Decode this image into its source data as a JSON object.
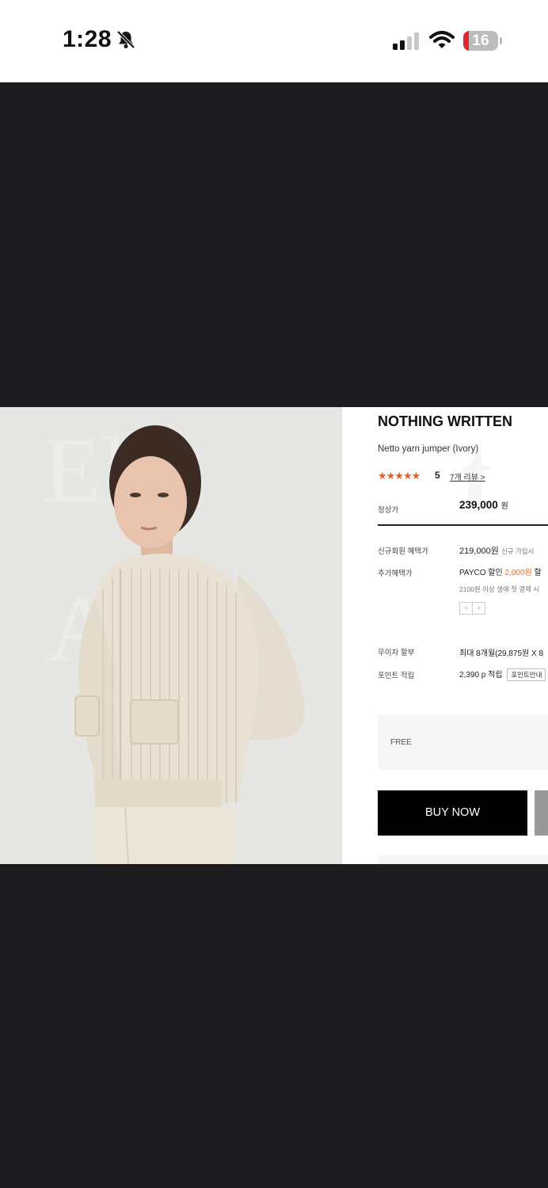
{
  "status_bar": {
    "time": "1:28",
    "battery": "16",
    "battery_level": 0.16,
    "battery_color": "#e3262b"
  },
  "product": {
    "brand": "NOTHING WRITTEN",
    "name": "Netto yarn jumper (Ivory)",
    "stars": "★★★★★",
    "rating": "5",
    "reviews": "7개 리뷰 >",
    "regular_price_label": "정상가",
    "regular_price": "239,000",
    "currency": "원",
    "member_label": "신규회원 혜택가",
    "member_price": "219,000원",
    "member_note": "신규 가입시",
    "extra_label": "추가혜택가",
    "payco_prefix": "PAYCO 할인",
    "payco_amount": "2,000원",
    "payco_suffix": "할",
    "payco_note": "2100원 이상 생애 첫 결제 시",
    "installment_label": "무이자 할부",
    "installment_value": "최대 8개월(29,875원 X 8",
    "points_label": "포인트 적립",
    "points_value": "2,390 p 적립",
    "points_button": "포인트안내",
    "option_value": "FREE",
    "buy_button": "BUY NOW",
    "accent_color": "#ef5a24"
  },
  "icons": {
    "bell": "bell-slash-icon",
    "signal": "cellular-signal-icon",
    "wifi": "wifi-icon",
    "battery": "battery-icon",
    "prev": "‹",
    "next": "›"
  }
}
